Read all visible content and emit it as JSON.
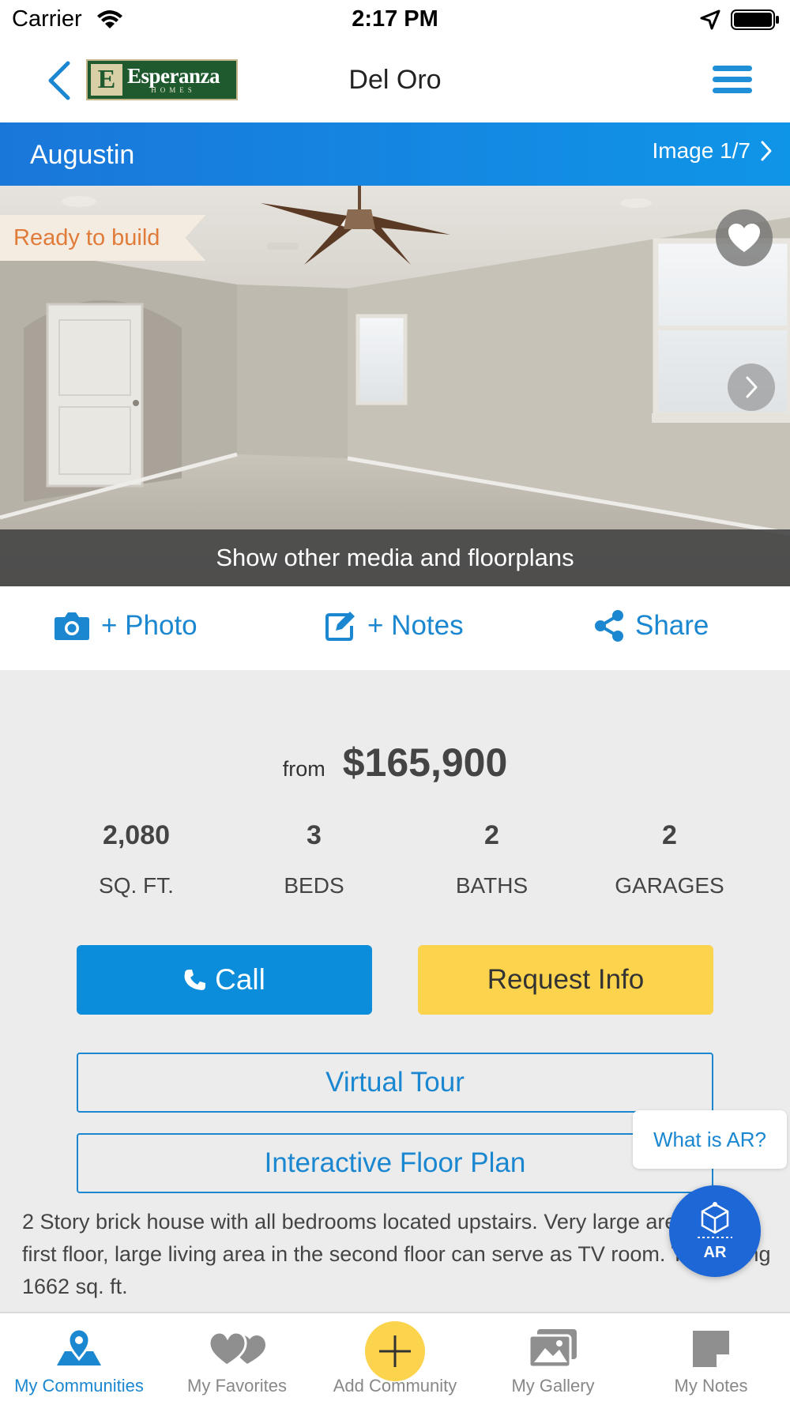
{
  "status_bar": {
    "carrier": "Carrier",
    "time": "2:17 PM"
  },
  "nav": {
    "logo_name": "Esperanza",
    "logo_sub": "HOMES",
    "title": "Del Oro",
    "accent_color": "#1a87d0"
  },
  "plan": {
    "name": "Augustin",
    "image_counter": "Image 1/7",
    "status_badge": "Ready to build",
    "media_link": "Show other media and floorplans"
  },
  "actions": {
    "photo": "+ Photo",
    "notes": "+ Notes",
    "share": "Share"
  },
  "price": {
    "prefix": "from",
    "value": "$165,900"
  },
  "stats": [
    {
      "value": "2,080",
      "label": "SQ. FT."
    },
    {
      "value": "3",
      "label": "BEDS"
    },
    {
      "value": "2",
      "label": "BATHS"
    },
    {
      "value": "2",
      "label": "GARAGES"
    }
  ],
  "buttons": {
    "call": "Call",
    "request_info": "Request Info",
    "virtual_tour": "Virtual Tour",
    "floor_plan": "Interactive Floor Plan",
    "call_color": "#0b8ddb",
    "request_color": "#fcd34d"
  },
  "description": "2 Story brick house with all bedrooms located upstairs. Very large areas in the first floor, large living area in the second floor can serve as TV room. Total living 1662 sq. ft.",
  "ar": {
    "tip": "What is AR?",
    "label": "AR"
  },
  "tabs": [
    {
      "label": "My Communities",
      "icon": "map-pin-icon",
      "active": true
    },
    {
      "label": "My Favorites",
      "icon": "hearts-icon",
      "active": false
    },
    {
      "label": "Add Community",
      "icon": "plus-icon",
      "active": false
    },
    {
      "label": "My Gallery",
      "icon": "gallery-icon",
      "active": false
    },
    {
      "label": "My Notes",
      "icon": "note-icon",
      "active": false
    }
  ]
}
